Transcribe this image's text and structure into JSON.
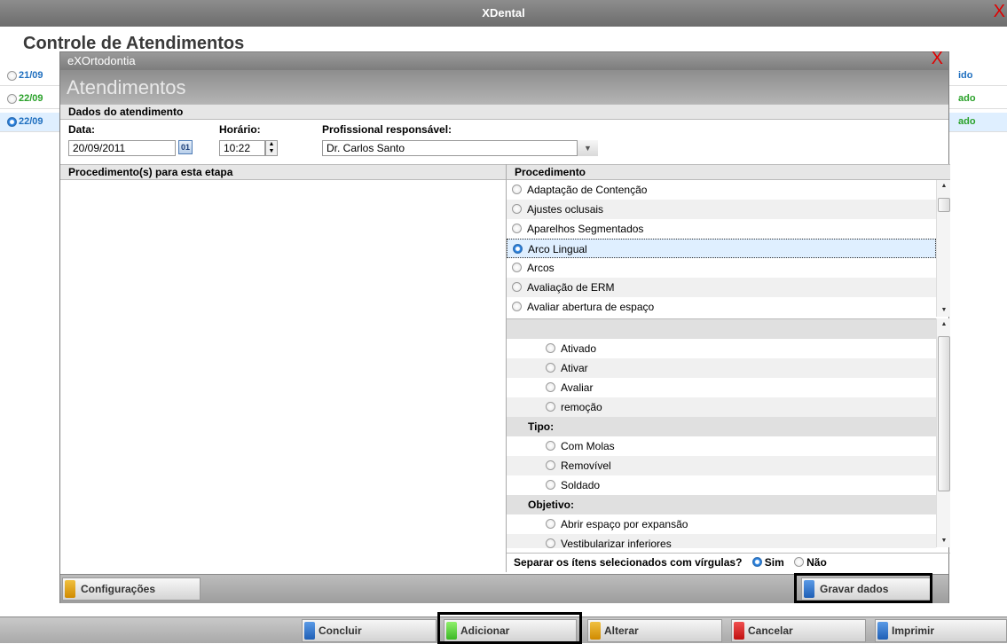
{
  "app": {
    "title": "XDental",
    "close": "X"
  },
  "page": {
    "title": "Controle de Atendimentos"
  },
  "background_rows": [
    {
      "date": "21/09",
      "status": "ido",
      "date_color": "#1f6fbf",
      "status_color": "#1f6fbf"
    },
    {
      "date": "22/09",
      "status": "ado",
      "date_color": "#2aa12a",
      "status_color": "#2aa12a"
    },
    {
      "date": "22/09",
      "status": "ado",
      "date_color": "#1f6fbf",
      "status_color": "#2aa12a"
    }
  ],
  "modal": {
    "window_title": "eXOrtodontia",
    "close": "X",
    "heading": "Atendimentos",
    "section_label": "Dados do atendimento",
    "date_label": "Data:",
    "date_value": "20/09/2011",
    "calendar_label": "01",
    "time_label": "Horário:",
    "time_value": "10:22",
    "professional_label": "Profissional responsável:",
    "professional_value": "Dr. Carlos Santo",
    "left_panel_title": "Procedimento(s) para esta etapa",
    "right_panel_title": "Procedimento",
    "procedures": [
      {
        "label": "Adaptação de Contenção",
        "selected": false
      },
      {
        "label": "Ajustes oclusais",
        "selected": false
      },
      {
        "label": "Aparelhos Segmentados",
        "selected": false
      },
      {
        "label": "Arco Lingual",
        "selected": true
      },
      {
        "label": "Arcos",
        "selected": false
      },
      {
        "label": "Avaliação de ERM",
        "selected": false
      },
      {
        "label": "Avaliar abertura de espaço",
        "selected": false
      }
    ],
    "options": {
      "first_group": [
        "Ativado",
        "Ativar",
        "Avaliar",
        "remoção"
      ],
      "tipo_label": "Tipo:",
      "tipo": [
        "Com Molas",
        "Removível",
        "Soldado"
      ],
      "objetivo_label": "Objetivo:",
      "objetivo": [
        "Abrir espaço por expansão",
        "Vestibularizar inferiores"
      ]
    },
    "separator_question": "Separar os ítens selecionados com vírgulas?",
    "separator_yes": "Sim",
    "separator_no": "Não",
    "configure_button": "Configurações",
    "save_button": "Gravar dados"
  },
  "bottom_bar": {
    "buttons": [
      {
        "label": "Concluir",
        "color": "#1f5fb5"
      },
      {
        "label": "Adicionar",
        "color": "#4cc83a"
      },
      {
        "label": "Alterar",
        "color": "#e0a000"
      },
      {
        "label": "Cancelar",
        "color": "#d11d1d"
      },
      {
        "label": "Imprimir",
        "color": "#1f5fb5"
      }
    ]
  },
  "colors": {
    "chip_blue": "#1f5fb5",
    "chip_gold": "#e0a000"
  }
}
